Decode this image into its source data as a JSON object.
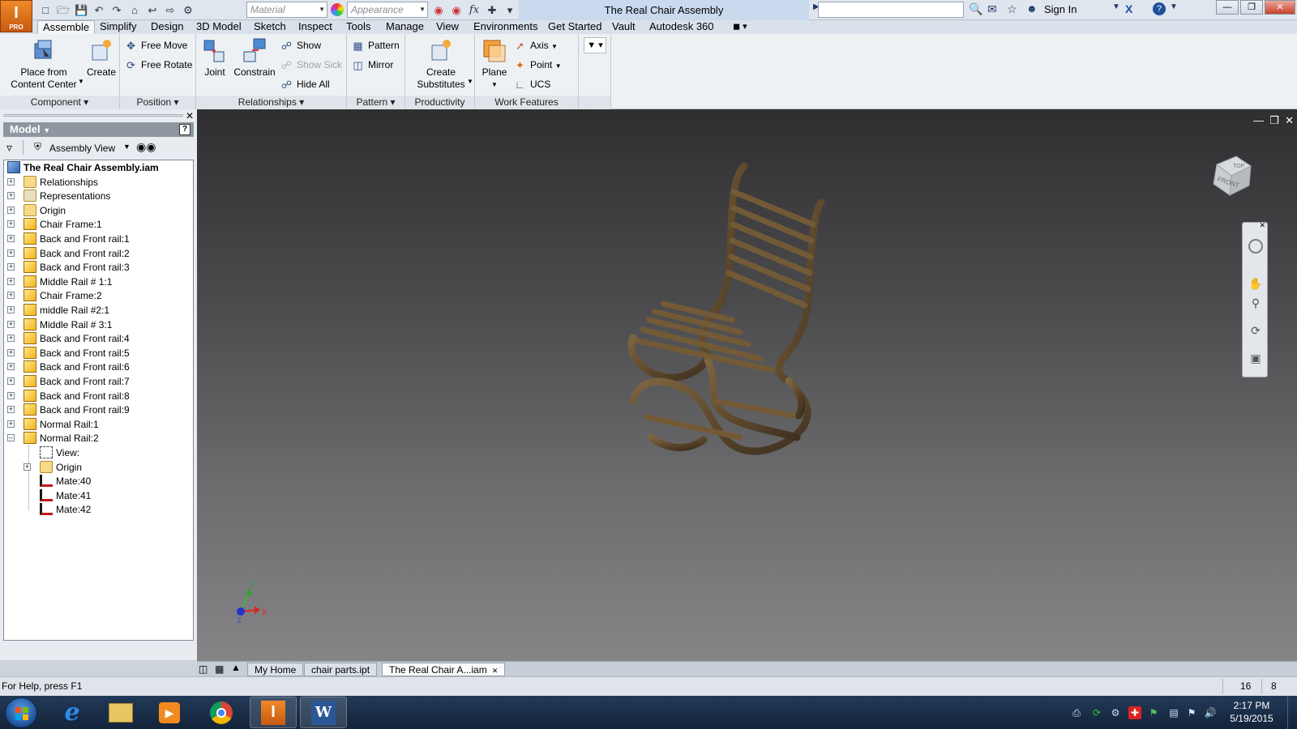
{
  "title_bar": {
    "app_badge": "I",
    "app_badge_sub": "PRO",
    "material_placeholder": "Material",
    "appearance_placeholder": "Appearance",
    "fx_label": "fx",
    "document_title": "The Real Chair Assembly",
    "sign_in": "Sign In",
    "search_value": ""
  },
  "menu_tabs": [
    {
      "label": "Assemble",
      "active": true
    },
    {
      "label": "Simplify"
    },
    {
      "label": "Design"
    },
    {
      "label": "3D Model"
    },
    {
      "label": "Sketch"
    },
    {
      "label": "Inspect"
    },
    {
      "label": "Tools"
    },
    {
      "label": "Manage"
    },
    {
      "label": "View"
    },
    {
      "label": "Environments"
    },
    {
      "label": "Get Started"
    },
    {
      "label": "Vault"
    },
    {
      "label": "Autodesk 360"
    }
  ],
  "ribbon": {
    "component": {
      "title": "Component",
      "place_from_content_center_line1": "Place from",
      "place_from_content_center_line2": "Content Center",
      "create": "Create"
    },
    "position": {
      "title": "Position",
      "free_move": "Free Move",
      "free_rotate": "Free Rotate"
    },
    "relationships": {
      "title": "Relationships",
      "joint": "Joint",
      "constrain": "Constrain",
      "show": "Show",
      "show_sick": "Show Sick",
      "hide_all": "Hide All"
    },
    "pattern": {
      "title": "Pattern",
      "pattern": "Pattern",
      "mirror": "Mirror"
    },
    "productivity": {
      "title": "Productivity",
      "create_substitutes_line1": "Create",
      "create_substitutes_line2": "Substitutes"
    },
    "work_features": {
      "title": "Work Features",
      "plane": "Plane",
      "axis": "Axis",
      "point": "Point",
      "ucs": "UCS"
    }
  },
  "browser": {
    "header": "Model",
    "help": "?",
    "view_selector": "Assembly View",
    "root": "The Real Chair Assembly.iam",
    "items": [
      {
        "label": "Relationships",
        "icon": "relationships"
      },
      {
        "label": "Representations",
        "icon": "representations"
      },
      {
        "label": "Origin",
        "icon": "folder"
      },
      {
        "label": "Chair Frame:1",
        "icon": "part"
      },
      {
        "label": "Back and Front rail:1",
        "icon": "part"
      },
      {
        "label": "Back and Front rail:2",
        "icon": "part"
      },
      {
        "label": "Back and Front rail:3",
        "icon": "part"
      },
      {
        "label": "Middle Rail # 1:1",
        "icon": "part"
      },
      {
        "label": "Chair Frame:2",
        "icon": "part"
      },
      {
        "label": "middle Rail #2:1",
        "icon": "part"
      },
      {
        "label": "Middle Rail # 3:1",
        "icon": "part"
      },
      {
        "label": "Back and Front rail:4",
        "icon": "part"
      },
      {
        "label": "Back and Front rail:5",
        "icon": "part"
      },
      {
        "label": "Back and Front rail:6",
        "icon": "part"
      },
      {
        "label": "Back and Front rail:7",
        "icon": "part"
      },
      {
        "label": "Back and Front rail:8",
        "icon": "part"
      },
      {
        "label": "Back and Front rail:9",
        "icon": "part"
      },
      {
        "label": "Normal Rail:1",
        "icon": "part"
      },
      {
        "label": "Normal Rail:2",
        "icon": "part",
        "expanded": true
      }
    ],
    "children": [
      {
        "label": "View:",
        "icon": "view"
      },
      {
        "label": "Origin",
        "icon": "folder"
      },
      {
        "label": "Mate:40",
        "icon": "mate"
      },
      {
        "label": "Mate:41",
        "icon": "mate"
      },
      {
        "label": "Mate:42",
        "icon": "mate"
      }
    ]
  },
  "viewport": {
    "viewcube_top": "TOP",
    "viewcube_front": "FRONT",
    "axis_x": "X",
    "axis_y": "Y",
    "axis_z": "Z",
    "wood_color": "#6b5331"
  },
  "document_tabs": [
    {
      "label": "My Home"
    },
    {
      "label": "chair parts.ipt"
    },
    {
      "label": "The Real Chair A...iam",
      "active": true
    }
  ],
  "status_bar": {
    "help_text": "For Help, press F1",
    "count1": "16",
    "count2": "8"
  },
  "taskbar": {
    "time": "2:17 PM",
    "date": "5/19/2015"
  }
}
